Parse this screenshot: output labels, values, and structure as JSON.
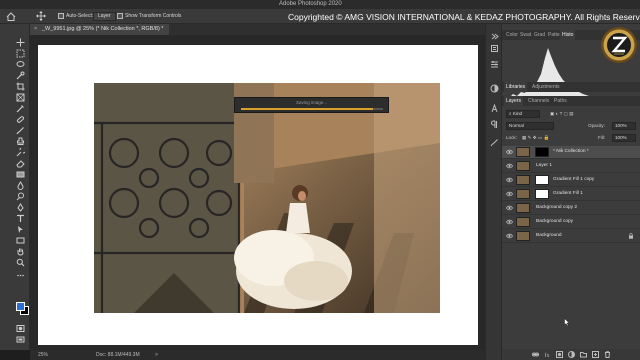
{
  "menubar": {
    "app_title": "Adobe Photoshop 2020"
  },
  "options": {
    "auto_select_label": "Auto-Select:",
    "auto_select_value": "Layer",
    "show_transform_label": "Show Transform Controls"
  },
  "watermark": "Copyrighted © AMG VISION INTERNATIONAL & KEDAZ PHOTOGRAPHY. All Rights Reserved",
  "document": {
    "tab_label": "_W_9951.jpg @ 25% (* Nik Collection *, RGB/8) *",
    "tab_close": "×"
  },
  "progress": {
    "text": "Saving image...",
    "value": 0.93
  },
  "status": {
    "zoom": "25%",
    "doc_size": "Doc: 88.1M/449.3M",
    "arrow": ">"
  },
  "top_panel": {
    "tabs": [
      "Color",
      "Swat",
      "Grad",
      "Patte",
      "Histo"
    ],
    "active": "Histo"
  },
  "libraries_panel": {
    "tabs": [
      "Libraries",
      "Adjustments"
    ]
  },
  "layers_panel": {
    "tabs": [
      "Layers",
      "Channels",
      "Paths"
    ],
    "kind_filter": "Kind",
    "blend_mode": "Normal",
    "opacity_label": "Opacity:",
    "opacity_value": "100%",
    "lock_label": "Lock:",
    "fill_label": "Fill:",
    "fill_value": "100%",
    "layers": [
      {
        "name": "* Nik Collection *",
        "selected": true,
        "mask": "black"
      },
      {
        "name": "Layer 1",
        "selected": false,
        "mask": ""
      },
      {
        "name": "Gradient Fill 1 copy",
        "selected": false,
        "mask": "white"
      },
      {
        "name": "Gradient Fill 1",
        "selected": false,
        "mask": "white"
      },
      {
        "name": "Background copy 2",
        "selected": false,
        "mask": ""
      },
      {
        "name": "Background copy",
        "selected": false,
        "mask": ""
      },
      {
        "name": "Background",
        "selected": false,
        "mask": "",
        "locked": true
      }
    ]
  },
  "colors": {
    "foreground": "#2e6ed3",
    "background": "#000000",
    "progress_fill": "#d7a32a",
    "panel": "#3c3c3c"
  }
}
